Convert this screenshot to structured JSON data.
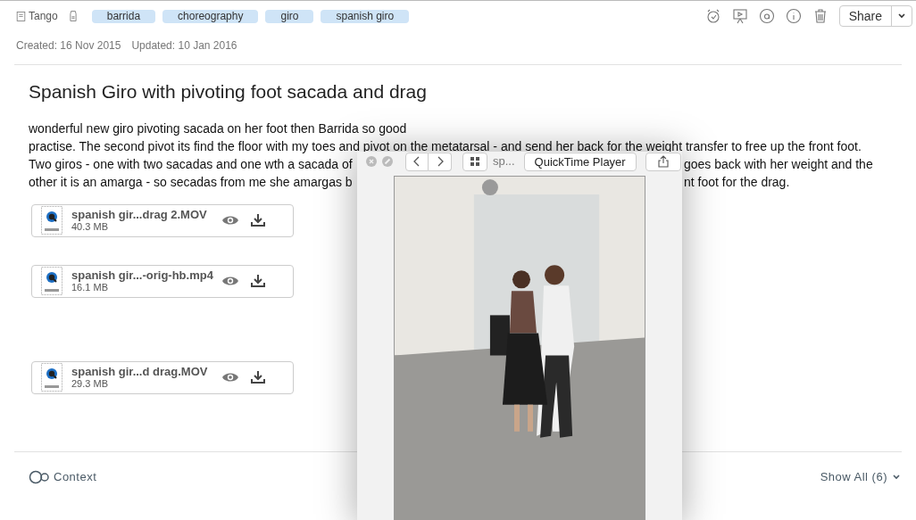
{
  "notebook": {
    "name": "Tango"
  },
  "tags": [
    {
      "label": "barrida"
    },
    {
      "label": "choreography"
    },
    {
      "label": "giro"
    },
    {
      "label": "spanish giro"
    }
  ],
  "share_button": {
    "label": "Share"
  },
  "dates": {
    "created": "Created: 16 Nov 2015",
    "updated": "Updated: 10 Jan 2016"
  },
  "note": {
    "title": "Spanish Giro with pivoting foot sacada and drag",
    "body_lines": [
      {
        "segments": [
          "wonderful new giro pivoting sacada on her foot then Barrida so good"
        ]
      },
      {
        "segments": [
          "practise. The second pivot its find the floor with my toes and pivot on the metatarsal - and send her back for the weight transfer to free up the front foot."
        ]
      },
      {
        "segments": [
          "Two giros - one with two sacadas and one wth a sacada of",
          "goes back with her weight and the"
        ]
      },
      {
        "segments": [
          "other it is an amarga - so secadas from me she amargas b",
          "nt foot for the drag."
        ]
      }
    ]
  },
  "attachments": [
    {
      "name": "spanish gir...drag 2.MOV",
      "size": "40.3 MB"
    },
    {
      "name": "spanish gir...-orig-hb.mp4",
      "size": "16.1 MB"
    },
    {
      "name": "spanish gir...d drag.MOV",
      "size": "29.3 MB"
    }
  ],
  "quicklook": {
    "file": "sp...",
    "open_with": "QuickTime Player"
  },
  "footer": {
    "context": "Context",
    "show_all": "Show All (6)"
  }
}
